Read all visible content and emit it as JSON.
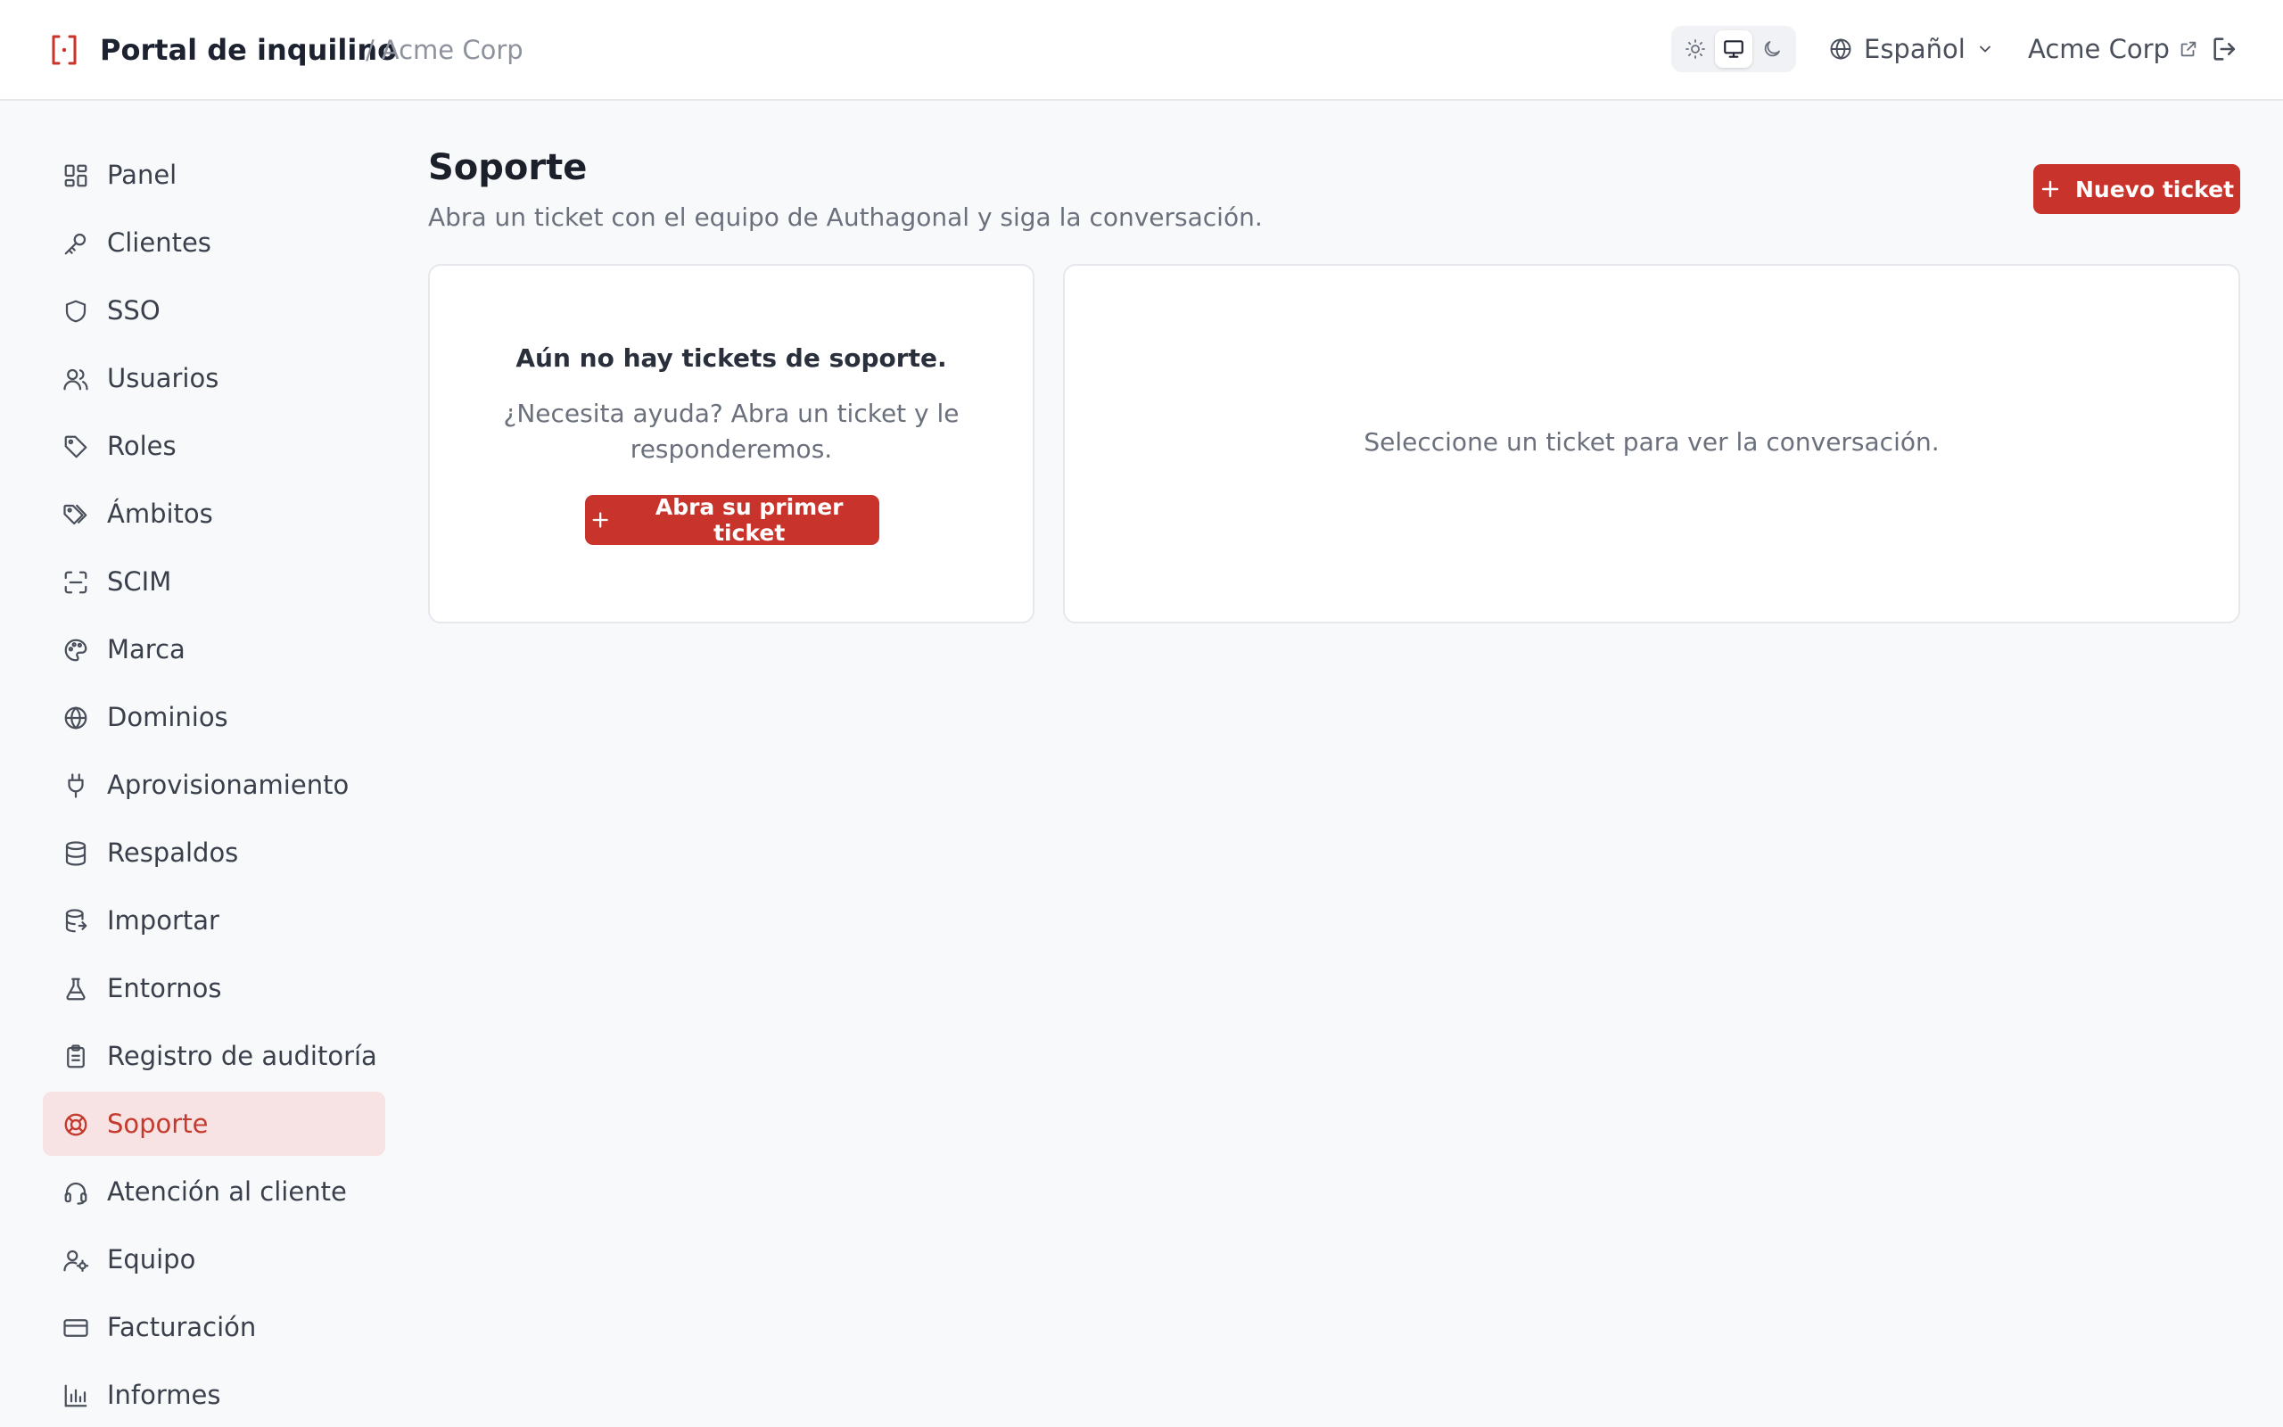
{
  "header": {
    "title": "Portal de inquilino",
    "separator": "/",
    "tenant": "Acme Corp",
    "theme_options": [
      {
        "name": "sun-icon",
        "active": false
      },
      {
        "name": "monitor-icon",
        "active": true
      },
      {
        "name": "moon-icon",
        "active": false
      }
    ],
    "language": "Español",
    "org_link": "Acme Corp"
  },
  "sidebar": {
    "items": [
      {
        "label": "Panel",
        "icon": "dashboard-icon"
      },
      {
        "label": "Clientes",
        "icon": "key-icon"
      },
      {
        "label": "SSO",
        "icon": "shield-icon"
      },
      {
        "label": "Usuarios",
        "icon": "users-icon"
      },
      {
        "label": "Roles",
        "icon": "tag-icon"
      },
      {
        "label": "Ámbitos",
        "icon": "tags-icon"
      },
      {
        "label": "SCIM",
        "icon": "scan-icon"
      },
      {
        "label": "Marca",
        "icon": "palette-icon"
      },
      {
        "label": "Dominios",
        "icon": "globe-icon"
      },
      {
        "label": "Aprovisionamiento",
        "icon": "plug-icon"
      },
      {
        "label": "Respaldos",
        "icon": "database-icon"
      },
      {
        "label": "Importar",
        "icon": "database-import-icon"
      },
      {
        "label": "Entornos",
        "icon": "flask-icon"
      },
      {
        "label": "Registro de auditoría",
        "icon": "clipboard-icon"
      },
      {
        "label": "Soporte",
        "icon": "lifebuoy-icon"
      },
      {
        "label": "Atención al cliente",
        "icon": "headset-icon"
      },
      {
        "label": "Equipo",
        "icon": "user-cog-icon"
      },
      {
        "label": "Facturación",
        "icon": "credit-card-icon"
      },
      {
        "label": "Informes",
        "icon": "bar-chart-icon"
      }
    ],
    "active": "Soporte"
  },
  "main": {
    "title": "Soporte",
    "subtitle": "Abra un ticket con el equipo de Authagonal y siga la conversación.",
    "new_ticket_label": "Nuevo ticket",
    "empty_state": {
      "title": "Aún no hay tickets de soporte.",
      "body": "¿Necesita ayuda? Abra un ticket y le responderemos.",
      "button_label": "Abra su primer ticket"
    },
    "conversation_placeholder": "Seleccione un ticket para ver la conversación."
  },
  "colors": {
    "accent": "#c8332b",
    "active_bg": "#f7e3e3",
    "active_text": "#c53a2e"
  }
}
